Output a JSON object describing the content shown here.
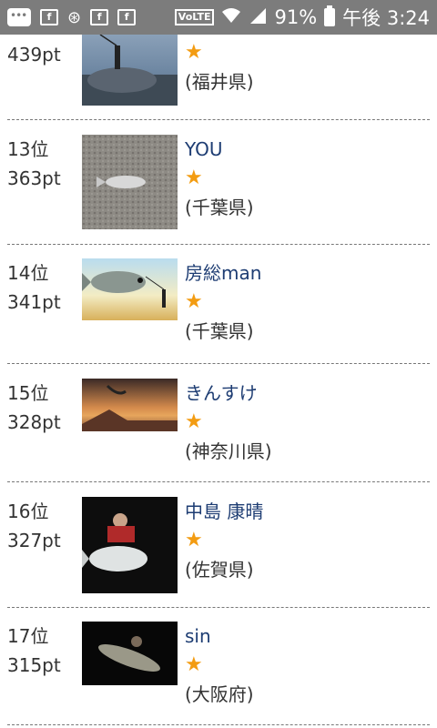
{
  "statusbar": {
    "battery": "91%",
    "time": "午後 3:24",
    "volte": "VoLTE"
  },
  "rows": [
    {
      "rank": "",
      "points": "439pt",
      "name": "",
      "star": "★",
      "pref": "(福井県)"
    },
    {
      "rank": "13位",
      "points": "363pt",
      "name": "YOU",
      "star": "★",
      "pref": "(千葉県)"
    },
    {
      "rank": "14位",
      "points": "341pt",
      "name": "房総man",
      "star": "★",
      "pref": "(千葉県)"
    },
    {
      "rank": "15位",
      "points": "328pt",
      "name": "きんすけ",
      "star": "★",
      "pref": "(神奈川県)"
    },
    {
      "rank": "16位",
      "points": "327pt",
      "name": "中島 康晴",
      "star": "★",
      "pref": "(佐賀県)"
    },
    {
      "rank": "17位",
      "points": "315pt",
      "name": "sin",
      "star": "★",
      "pref": "(大阪府)"
    }
  ]
}
